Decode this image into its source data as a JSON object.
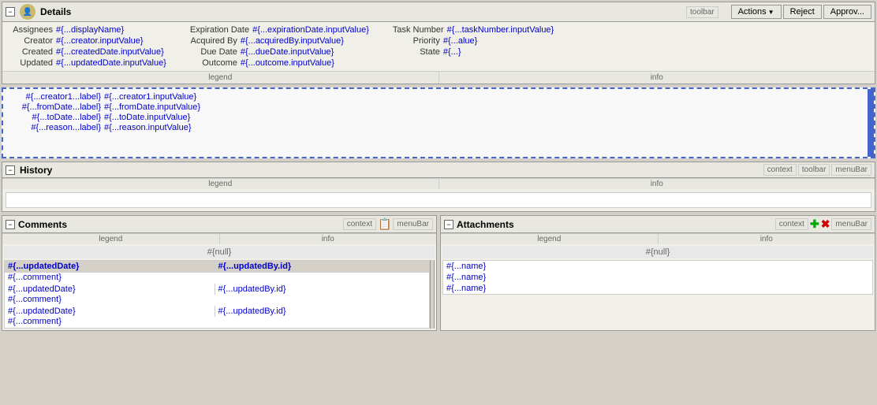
{
  "details": {
    "title": "Details",
    "toolbar_label": "toolbar",
    "fields": {
      "assignees_label": "Assignees",
      "assignees_value": "#{...displayName}",
      "creator_label": "Creator",
      "creator_value": "#{...creator.inputValue}",
      "created_label": "Created",
      "created_value": "#{...createdDate.inputValue}",
      "updated_label": "Updated",
      "updated_value": "#{...updatedDate.inputValue}",
      "expiration_label": "Expiration Date",
      "expiration_value": "#{...expirationDate.inputValue}",
      "acquired_label": "Acquired By",
      "acquired_value": "#{...acquiredBy.inputValue}",
      "due_label": "Due Date",
      "due_value": "#{...dueDate.inputValue}",
      "outcome_label": "Outcome",
      "outcome_value": "#{...outcome.inputValue}",
      "task_label": "Task Number",
      "task_value": "#{...taskNumber.inputValue}",
      "priority_label": "Priority",
      "priority_value": "#{...alue}",
      "state_label": "State",
      "state_value": "#{...}"
    },
    "footer_legend": "legend",
    "footer_info": "info"
  },
  "actions": {
    "label": "Actions",
    "reject_label": "Reject",
    "approve_label": "Approv..."
  },
  "middle": {
    "creator1_label": "#{...creator1...label}",
    "creator1_value": "#{...creator1.inputValue}",
    "from_label": "#{...fromDate...label}",
    "from_value": "#{...fromDate.inputValue}",
    "to_label": "#{...toDate...label}",
    "to_value": "#{...toDate.inputValue}",
    "reason_label": "#{...reason...label}",
    "reason_value": "#{...reason.inputValue}"
  },
  "history": {
    "title": "History",
    "context_label": "context",
    "toolbar_label": "toolbar",
    "menu_label": "menuBar",
    "footer_legend": "legend",
    "footer_info": "info"
  },
  "comments": {
    "title": "Comments",
    "context_label": "context",
    "menu_label": "menuBar",
    "footer_legend": "legend",
    "footer_info": "info",
    "null_value": "#{null}",
    "header_date": "#{...updatedDate}",
    "header_by": "#{...updatedBy.id}",
    "rows": [
      {
        "comment": "#{...comment}",
        "date": "",
        "by": ""
      },
      {
        "comment": "",
        "date": "#{...updatedDate}",
        "by": "#{...updatedBy.id}"
      },
      {
        "comment": "#{...comment}",
        "date": "",
        "by": ""
      },
      {
        "comment": "",
        "date": "#{...updatedDate}",
        "by": "#{...updatedBy.id}"
      },
      {
        "comment": "#{...comment}",
        "date": "",
        "by": ""
      }
    ]
  },
  "attachments": {
    "title": "Attachments",
    "context_label": "context",
    "menu_label": "menuBar",
    "footer_legend": "legend",
    "footer_info": "info",
    "null_value": "#{null}",
    "items": [
      "#{...name}",
      "#{...name}",
      "#{...name}"
    ]
  }
}
